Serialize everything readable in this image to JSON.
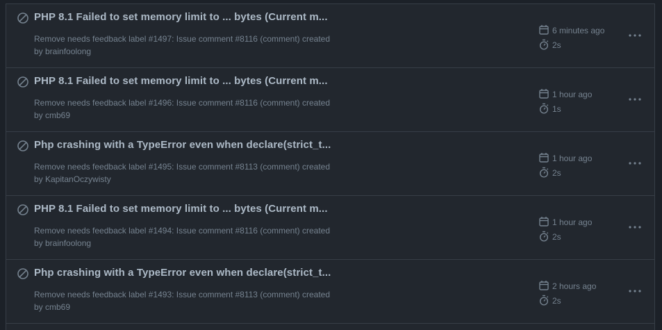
{
  "runs": [
    {
      "title": "PHP 8.1 Failed to set memory limit to ... bytes (Current m...",
      "workflow": "Remove needs feedback label #1497: Issue comment #8116 (comment) created",
      "author": "by brainfoolong",
      "time": "6 minutes ago",
      "duration": "2s"
    },
    {
      "title": "PHP 8.1 Failed to set memory limit to ... bytes (Current m...",
      "workflow": "Remove needs feedback label #1496: Issue comment #8116 (comment) created",
      "author": "by cmb69",
      "time": "1 hour ago",
      "duration": "1s"
    },
    {
      "title": "Php crashing with a TypeError even when declare(strict_t...",
      "workflow": "Remove needs feedback label #1495: Issue comment #8113 (comment) created",
      "author": "by KapitanOczywisty",
      "time": "1 hour ago",
      "duration": "2s"
    },
    {
      "title": "PHP 8.1 Failed to set memory limit to ... bytes (Current m...",
      "workflow": "Remove needs feedback label #1494: Issue comment #8116 (comment) created",
      "author": "by brainfoolong",
      "time": "1 hour ago",
      "duration": "2s"
    },
    {
      "title": "Php crashing with a TypeError even when declare(strict_t...",
      "workflow": "Remove needs feedback label #1493: Issue comment #8113 (comment) created",
      "author": "by cmb69",
      "time": "2 hours ago",
      "duration": "2s"
    }
  ],
  "icons": {
    "status": "skipped-icon",
    "time": "calendar-icon",
    "duration": "stopwatch-icon",
    "menu": "kebab-horizontal-icon"
  },
  "colors": {
    "background": "#22272e",
    "border": "#373e47",
    "title": "#adbac7",
    "muted": "#768390"
  }
}
